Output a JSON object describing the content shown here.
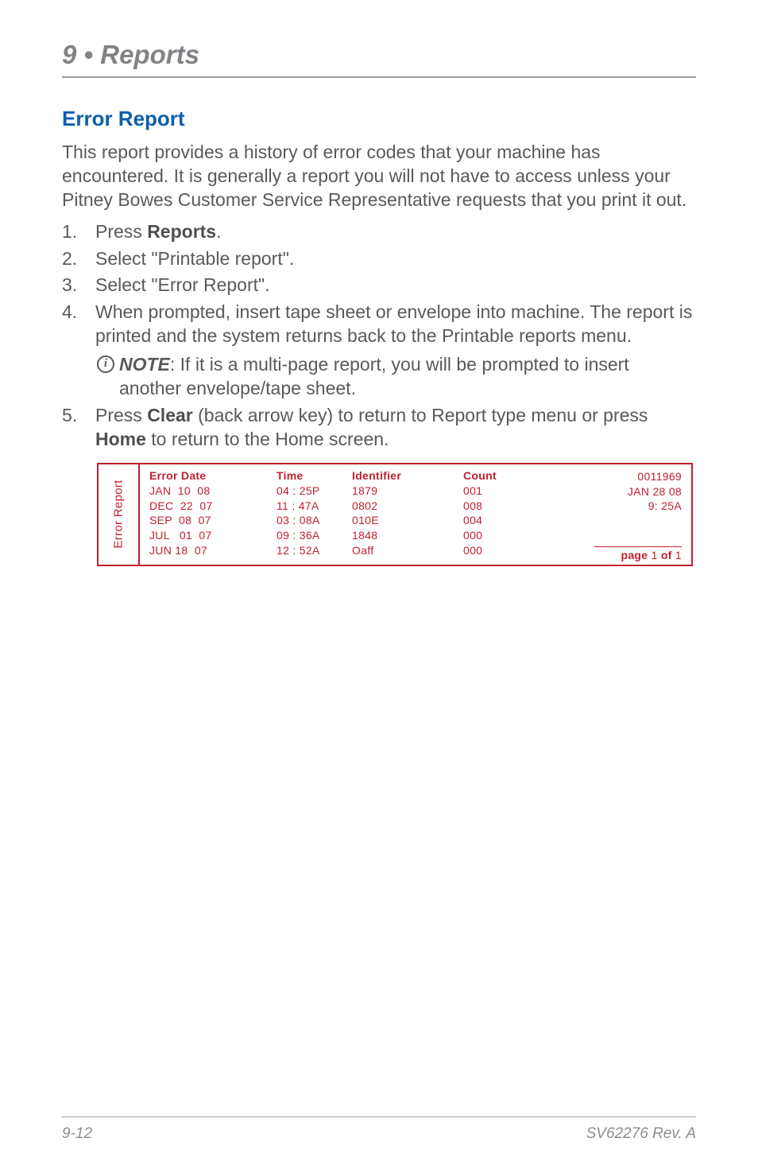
{
  "chapter": {
    "label": "9 • Reports"
  },
  "section": {
    "title": "Error Report"
  },
  "intro": "This report provides a history of error codes that your machine has encountered. It is generally a report you will not have to access unless your Pitney Bowes Customer Service Representative requests that you print it out.",
  "steps": {
    "s1_a": "Press ",
    "s1_b": "Reports",
    "s1_c": ".",
    "s2": "Select \"Printable report\".",
    "s3": "Select \"Error Report\".",
    "s4": "When prompted, insert tape sheet or envelope into machine. The report is printed and the system returns back to the Printable reports menu.",
    "note_label": "NOTE",
    "note_text": ": If it is a multi-page report, you will be prompted to insert another envelope/tape sheet.",
    "s5_a": "Press ",
    "s5_b": "Clear",
    "s5_c": " (back arrow key) to return to Report type menu or press ",
    "s5_d": "Home",
    "s5_e": " to return to the Home screen."
  },
  "ticket": {
    "side_label": "Error\nReport",
    "headers": {
      "date": "Error Date",
      "time": "Time",
      "identifier": "Identifier",
      "count": "Count"
    },
    "rows": [
      {
        "date": "JAN  10  08",
        "time": "04 : 25P",
        "identifier": "1879",
        "count": "001"
      },
      {
        "date": "DEC  22  07",
        "time": "11 : 47A",
        "identifier": "0802",
        "count": "008"
      },
      {
        "date": "SEP  08  07",
        "time": "03 : 08A",
        "identifier": "010E",
        "count": "004"
      },
      {
        "date": "JUL   01  07",
        "time": "09 : 36A",
        "identifier": "1848",
        "count": "000"
      },
      {
        "date": "JUN 18  07",
        "time": "12 : 52A",
        "identifier": "Oaff",
        "count": "000"
      }
    ],
    "meta": {
      "serial": "0011969",
      "date": "JAN  28  08",
      "time": "9: 25A"
    },
    "page": {
      "prefix": "page",
      "n": "1",
      "of_word": "of",
      "total": "1"
    }
  },
  "footer": {
    "left": "9-12",
    "right": "SV62276 Rev. A"
  }
}
